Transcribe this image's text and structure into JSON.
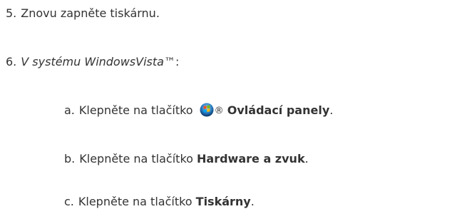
{
  "steps": [
    {
      "number": "5.",
      "text": "Znovu zapněte tiskárnu."
    },
    {
      "number": "6.",
      "text_italic": "V systému WindowsVista",
      "tm": "™",
      "colon": ":"
    }
  ],
  "substeps": [
    {
      "letter": "a.",
      "text": "Klepněte na tlačítko ",
      "icon": "windows-start-orb-icon",
      "reg": "®",
      "bold": "Ovládací panely",
      "end": "."
    },
    {
      "letter": "b.",
      "text": "Klepněte na tlačítko ",
      "bold": "Hardware a zvuk",
      "end": "."
    },
    {
      "letter": "c.",
      "text": "Klepněte na tlačítko ",
      "bold": "Tiskárny",
      "end": "."
    }
  ]
}
